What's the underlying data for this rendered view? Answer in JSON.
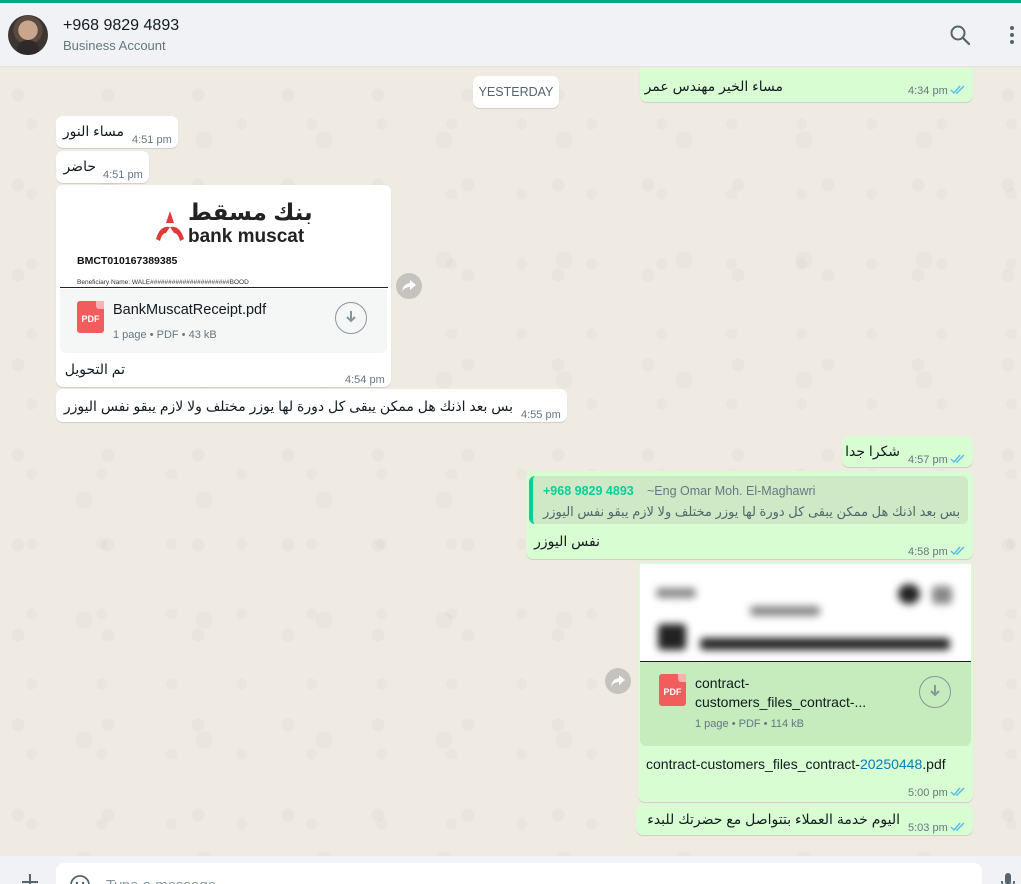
{
  "header": {
    "contact_name": "+968 9829 4893",
    "contact_subtitle": "Business Account",
    "icons": [
      "search-icon",
      "menu-icon"
    ]
  },
  "date_chip": "YESTERDAY",
  "messages": [
    {
      "dir": "out",
      "text": "مساء الخير مهندس عمر",
      "time": "4:34 pm",
      "status": "read"
    },
    {
      "dir": "in",
      "text": "مساء النور",
      "time": "4:51 pm"
    },
    {
      "dir": "in",
      "text": "حاضر",
      "time": "4:51 pm"
    },
    {
      "dir": "in",
      "type": "document",
      "preview": {
        "logo_ar": "بنك مسقط",
        "logo_en": "bank muscat",
        "reference": "BMCT010167389385",
        "beneficiary": "Beneficiary Name:  WALE######################BOOD"
      },
      "file_name": "BankMuscatReceipt.pdf",
      "file_meta": "1 page • PDF • 43 kB",
      "caption": "تم التحويل",
      "time": "4:54 pm"
    },
    {
      "dir": "in",
      "text": "بس بعد اذنك هل ممكن يبقى كل دورة لها يوزر مختلف ولا لازم يبقو نفس اليوزر",
      "time": "4:55 pm"
    },
    {
      "dir": "out",
      "text": "شكرا جدا",
      "time": "4:57 pm",
      "status": "read"
    },
    {
      "dir": "out",
      "type": "reply",
      "quote_author": "+968 9829 4893",
      "quote_alias": "~Eng Omar Moh. El-Maghawri",
      "quote_text": "بس بعد اذنك هل ممكن يبقى كل دورة لها يوزر مختلف ولا لازم يبقو نفس اليوزر",
      "text": "نفس اليوزر",
      "time": "4:58 pm",
      "status": "read"
    },
    {
      "dir": "out",
      "type": "document",
      "file_name_line1": "contract-",
      "file_name_line2": "customers_files_contract-...",
      "file_meta": "1 page • PDF • 114 kB",
      "caption_prefix": "contract-customers_files_contract-",
      "caption_link": "20250448",
      "caption_suffix": ".pdf",
      "time": "5:00 pm",
      "status": "read"
    },
    {
      "dir": "out",
      "text": "اليوم خدمة العملاء بتتواصل مع حضرتك للبدء",
      "time": "5:03 pm",
      "status": "read"
    }
  ],
  "pdf_badge": "PDF",
  "composer": {
    "placeholder": "Type a message"
  },
  "colors": {
    "accent": "#00a884",
    "outgoing": "#d9fdd3",
    "incoming": "#ffffff",
    "read_ticks": "#53bdeb",
    "pdf": "#f15c5c"
  }
}
